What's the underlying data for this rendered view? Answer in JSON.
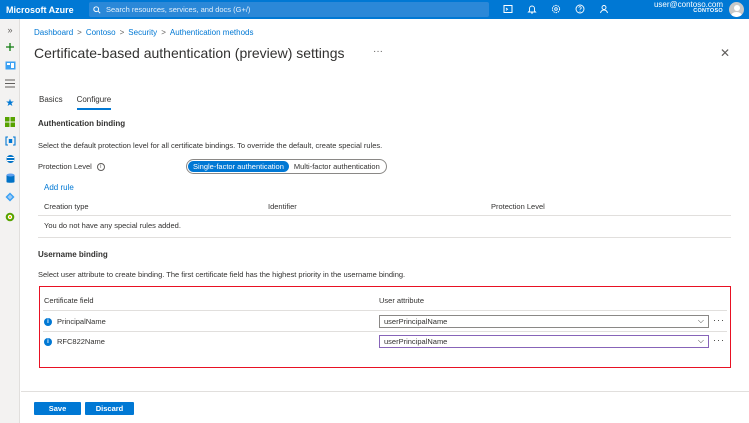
{
  "topbar": {
    "brand": "Microsoft Azure",
    "search_placeholder": "Search resources, services, and docs (G+/)",
    "user_email": "user@contoso.com",
    "user_tenant": "CONTOSO",
    "icons": [
      "cloud-shell-icon",
      "notifications-icon",
      "settings-icon",
      "help-icon",
      "feedback-icon"
    ]
  },
  "breadcrumb": [
    "Dashboard",
    "Contoso",
    "Security",
    "Authentication methods"
  ],
  "page": {
    "title": "Certificate-based authentication (preview) settings",
    "more": "···",
    "close": "✕"
  },
  "tabs": [
    {
      "label": "Basics",
      "active": false
    },
    {
      "label": "Configure",
      "active": true
    }
  ],
  "auth_binding": {
    "title": "Authentication binding",
    "description": "Select the default protection level for all certificate bindings. To override the default, create special rules.",
    "protection_label": "Protection Level",
    "options": [
      "Single-factor authentication",
      "Multi-factor authentication"
    ],
    "selected": "Single-factor authentication",
    "add_rule": "Add rule",
    "columns": [
      "Creation type",
      "Identifier",
      "Protection Level"
    ],
    "empty_message": "You do not have any special rules added."
  },
  "username_binding": {
    "title": "Username binding",
    "description": "Select user attribute to create binding. The first certificate field has the highest priority in the username binding.",
    "columns": [
      "Certificate field",
      "User attribute"
    ],
    "rows": [
      {
        "field": "PrincipalName",
        "attribute": "userPrincipalName"
      },
      {
        "field": "RFC822Name",
        "attribute": "userPrincipalName"
      }
    ]
  },
  "footer": {
    "save": "Save",
    "discard": "Discard"
  },
  "colors": {
    "accent": "#0078d4",
    "highlight_box": "#e81123"
  }
}
